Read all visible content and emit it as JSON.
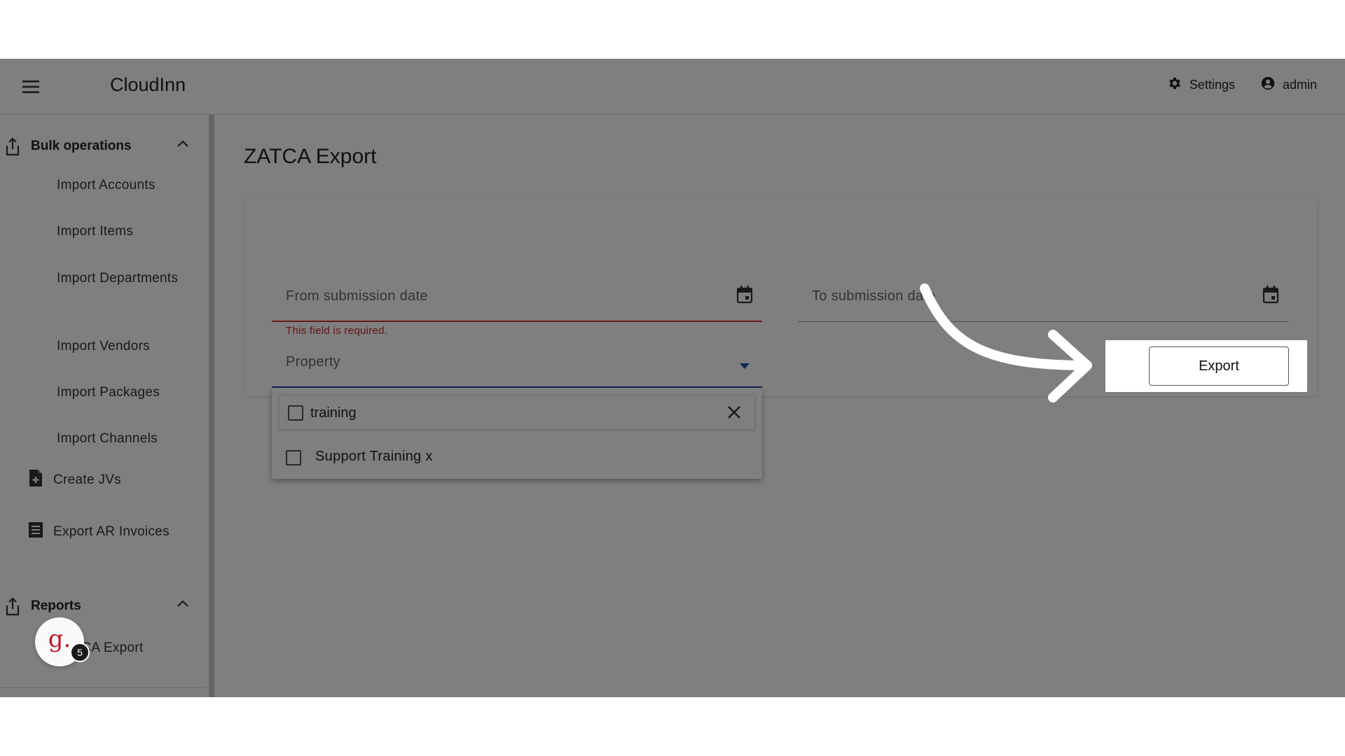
{
  "app": {
    "title": "CloudInn"
  },
  "topbar": {
    "settings_label": "Settings",
    "user_label": "admin"
  },
  "sidebar": {
    "bulk_operations": {
      "label": "Bulk operations",
      "items": [
        "Import Accounts",
        "Import Items",
        "Import Departments",
        "Import Vendors",
        "Import Packages",
        "Import Channels"
      ]
    },
    "nav": [
      {
        "label": "Create JVs",
        "icon": "file-plus-icon"
      },
      {
        "label": "Export AR Invoices",
        "icon": "list-document-icon"
      }
    ],
    "reports": {
      "label": "Reports",
      "items": [
        "ZATCA Export"
      ]
    }
  },
  "avatar": {
    "letter": "g.",
    "badge_count": "5"
  },
  "page": {
    "title": "ZATCA Export"
  },
  "form": {
    "from_date_label": "From submission date",
    "to_date_label": "To submission date",
    "required_error": "This field is required.",
    "property_label": "Property",
    "search_value": "training",
    "options": [
      "Support Training x"
    ],
    "export_label": "Export"
  },
  "colors": {
    "error": "#c62828",
    "focus": "#1e4ea8",
    "overlay": "rgba(0,0,0,0.5)"
  }
}
